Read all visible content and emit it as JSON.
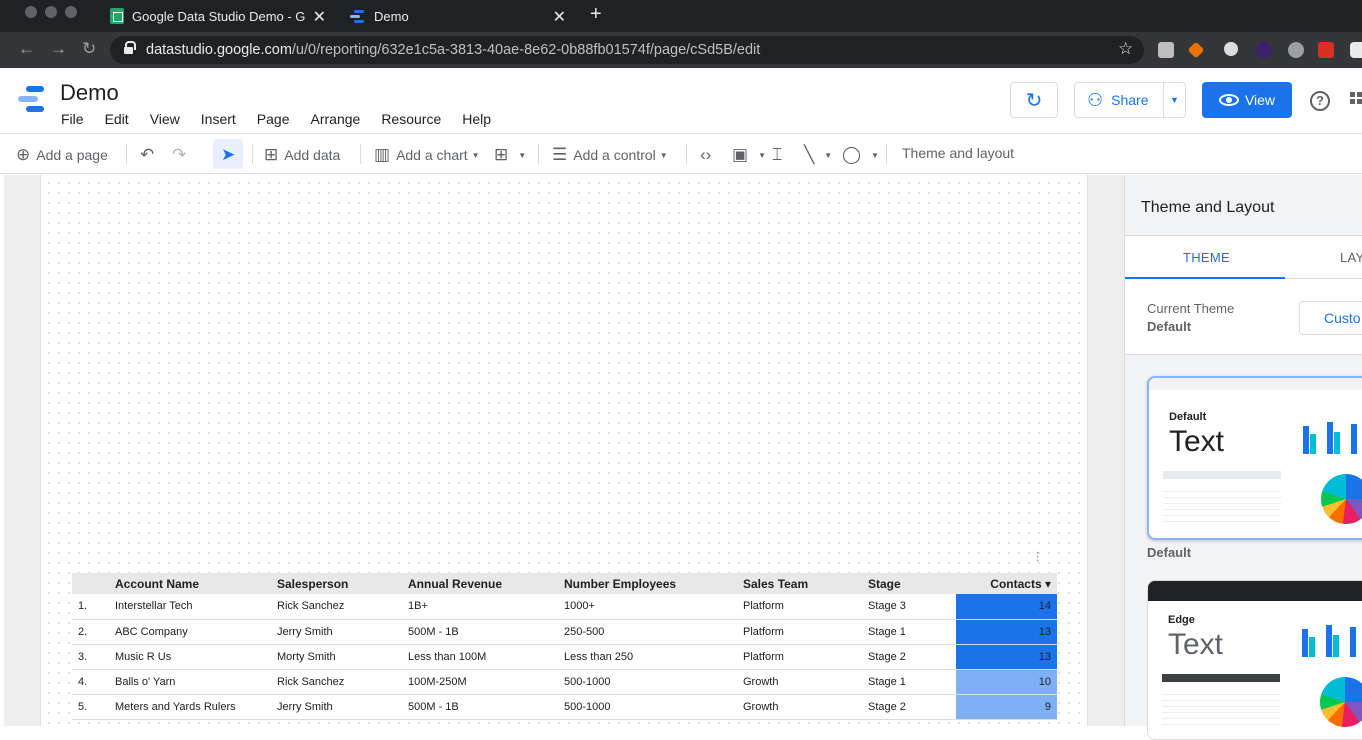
{
  "browser": {
    "tabs": [
      {
        "title": "Google Data Studio Demo - Go",
        "active": false
      },
      {
        "title": "Demo",
        "active": true
      }
    ],
    "url_host": "datastudio.google.com",
    "url_path": "/u/0/reporting/632e1c5a-3813-40ae-8e62-0b88fb01574f/page/cSd5B/edit"
  },
  "app": {
    "title": "Demo",
    "menu": [
      "File",
      "Edit",
      "View",
      "Insert",
      "Page",
      "Arrange",
      "Resource",
      "Help"
    ],
    "share_label": "Share",
    "view_label": "View"
  },
  "toolbar": {
    "add_page": "Add a page",
    "add_data": "Add data",
    "add_chart": "Add a chart",
    "add_control": "Add a control",
    "theme_layout": "Theme and layout"
  },
  "table": {
    "columns": [
      "",
      "Account Name",
      "Salesperson",
      "Annual Revenue",
      "Number Employees",
      "Sales Team",
      "Stage",
      "Contacts ▾"
    ],
    "rows": [
      [
        "1.",
        "Interstellar Tech",
        "Rick Sanchez",
        "1B+",
        "1000+",
        "Platform",
        "Stage 3",
        "14"
      ],
      [
        "2.",
        "ABC Company",
        "Jerry Smith",
        "500M - 1B",
        "250-500",
        "Platform",
        "Stage 1",
        "13"
      ],
      [
        "3.",
        "Music R Us",
        "Morty Smith",
        "Less than 100M",
        "Less than 250",
        "Platform",
        "Stage 2",
        "13"
      ],
      [
        "4.",
        "Balls o' Yarn",
        "Rick Sanchez",
        "100M-250M",
        "500-1000",
        "Growth",
        "Stage 1",
        "10"
      ],
      [
        "5.",
        "Meters and Yards Rulers",
        "Jerry Smith",
        "500M - 1B",
        "500-1000",
        "Growth",
        "Stage 2",
        "9"
      ]
    ],
    "contacts_max": 14,
    "heat_color_strong": "#1a73e8",
    "heat_color_light": "#8ab4f8"
  },
  "panel": {
    "title": "Theme and Layout",
    "tab_theme": "THEME",
    "tab_layout": "LAY",
    "current_theme_label": "Current Theme",
    "current_theme_value": "Default",
    "customize_label": "Custo",
    "themes": [
      {
        "name": "Default",
        "sample_text": "Text",
        "label": "Default"
      },
      {
        "name": "Edge",
        "sample_text": "Text"
      }
    ]
  },
  "colors": {
    "accent": "#1a73e8",
    "chrome_dark": "#202124"
  }
}
